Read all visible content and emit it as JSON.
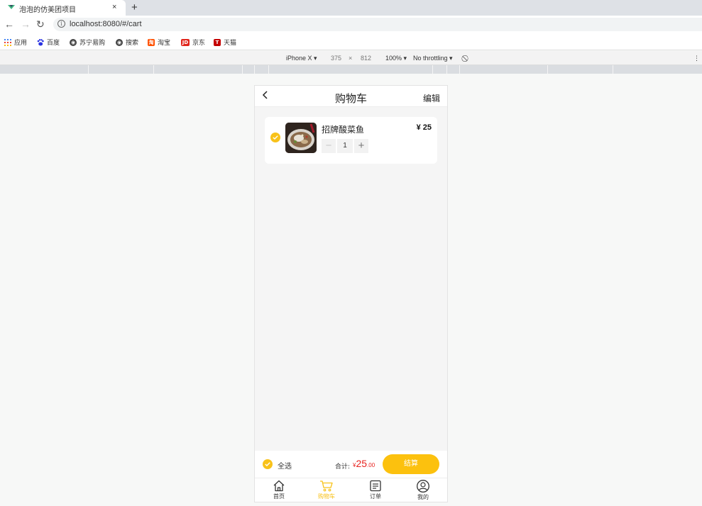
{
  "browser": {
    "tab_title": "泡泡的仿美团项目",
    "tab_close": "×",
    "new_tab": "+",
    "url": "localhost:8080/#/cart",
    "bookmarks": [
      {
        "label": "应用",
        "icon": "apps-grid-icon",
        "color": "#4285f4"
      },
      {
        "label": "百度",
        "icon": "baidu-paw-icon",
        "color": "#2932e1"
      },
      {
        "label": "苏宁易购",
        "icon": "globe-icon",
        "color": "#444444"
      },
      {
        "label": "搜索",
        "icon": "globe-icon",
        "color": "#444444"
      },
      {
        "label": "淘宝",
        "icon": "taobao-icon",
        "color": "#ff5000"
      },
      {
        "label": "京东",
        "icon": "jd-icon",
        "color": "#e1251b"
      },
      {
        "label": "天猫",
        "icon": "tmall-icon",
        "color": "#c40000"
      }
    ],
    "devtools": {
      "device": "iPhone X",
      "width": "375",
      "times": "×",
      "height": "812",
      "zoom": "100%",
      "throttling": "No throttling"
    }
  },
  "app": {
    "header": {
      "title": "购物车",
      "edit": "编辑"
    },
    "cart_items": [
      {
        "name": "招牌酸菜鱼",
        "price": "¥ 25",
        "quantity": "1",
        "checked": true
      }
    ],
    "footer": {
      "select_all": "全选",
      "total_label": "合计:",
      "currency": "¥",
      "total_int": "25",
      "total_dec": ".00",
      "checkout": "结算"
    },
    "tabs": [
      {
        "label": "首页",
        "icon": "home-icon",
        "active": false
      },
      {
        "label": "购物车",
        "icon": "cart-icon",
        "active": true
      },
      {
        "label": "订单",
        "icon": "order-icon",
        "active": false
      },
      {
        "label": "我的",
        "icon": "user-icon",
        "active": false
      }
    ],
    "colors": {
      "accent": "#f8c21a",
      "checkout": "#fcc10e",
      "price": "#e8231f"
    }
  }
}
